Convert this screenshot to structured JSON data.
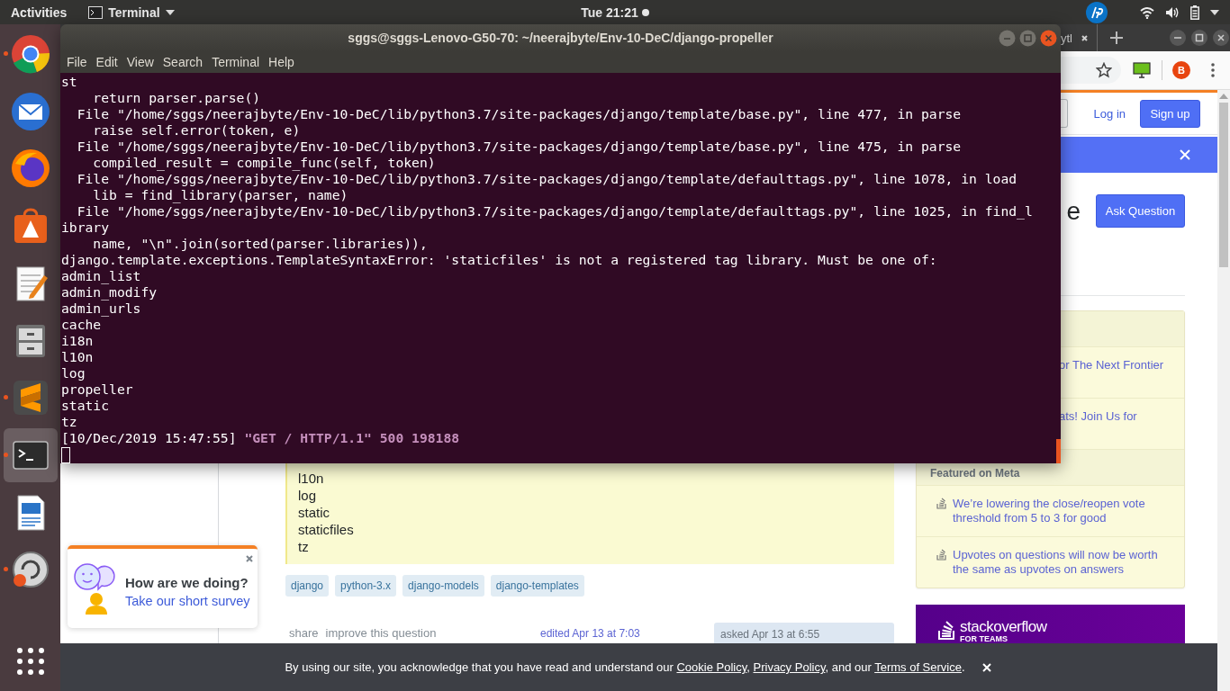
{
  "top_bar": {
    "activities": "Activities",
    "app_menu": "Terminal",
    "clock": "Tue 21:21",
    "notification": true
  },
  "dock": [
    {
      "kind": "chrome",
      "running": true,
      "selected": false
    },
    {
      "kind": "mail",
      "running": false,
      "selected": false
    },
    {
      "kind": "firefox",
      "running": false,
      "selected": false
    },
    {
      "kind": "store",
      "running": false,
      "selected": false
    },
    {
      "kind": "editor",
      "running": false,
      "selected": false
    },
    {
      "kind": "files",
      "running": false,
      "selected": false
    },
    {
      "kind": "sublime",
      "running": true,
      "selected": false
    },
    {
      "kind": "terminal",
      "running": true,
      "selected": true
    },
    {
      "kind": "writer",
      "running": false,
      "selected": false
    },
    {
      "kind": "updater",
      "running": true,
      "selected": false
    },
    {
      "kind": "apps",
      "running": false,
      "selected": false
    }
  ],
  "browser": {
    "tab": {
      "title": "ytl"
    },
    "avatar": "B",
    "page": {
      "login": "Log in",
      "signup": "Sign up",
      "title_fragment": "e",
      "ask_button": "Ask Question",
      "code_lines": [
        "l10n",
        "log",
        "static",
        "staticfiles",
        "tz"
      ],
      "tags": [
        "django",
        "python-3.x",
        "django-models",
        "django-templates"
      ],
      "post_menu": [
        "share",
        "improve this question"
      ],
      "edited": "edited Apr 13 at 7:03",
      "asked": "asked Apr 13 at 6:55",
      "sidebar": {
        "blog_items": [
          "or The Next Frontier",
          "ats! Join Us for"
        ],
        "meta_heading": "Featured on Meta",
        "meta_items": [
          "We’re lowering the close/reopen vote threshold from 5 to 3 for good",
          "Upvotes on questions will now be worth the same as upvotes on answers"
        ]
      },
      "teams_ad": {
        "logo": "stack**overflow**",
        "subtitle": "FOR TEAMS"
      },
      "survey": {
        "title": "How are we doing?",
        "link": "Take our short survey"
      },
      "cookie_notice": [
        {
          "kind": "text",
          "text": "By using our site, you acknowledge that you have read and understand our "
        },
        {
          "kind": "link",
          "text": "Cookie Policy"
        },
        {
          "kind": "text",
          "text": ", "
        },
        {
          "kind": "link",
          "text": "Privacy Policy"
        },
        {
          "kind": "text",
          "text": ", and our "
        },
        {
          "kind": "link",
          "text": "Terms of Service"
        },
        {
          "kind": "text",
          "text": "."
        }
      ]
    }
  },
  "terminal": {
    "title": "sggs@sggs-Lenovo-G50-70: ~/neerajbyte/Env-10-DeC/django-propeller",
    "menu": [
      "File",
      "Edit",
      "View",
      "Search",
      "Terminal",
      "Help"
    ],
    "lines": [
      "st",
      "    return parser.parse()",
      "  File \"/home/sggs/neerajbyte/Env-10-DeC/lib/python3.7/site-packages/django/template/base.py\", line 477, in parse",
      "    raise self.error(token, e)",
      "  File \"/home/sggs/neerajbyte/Env-10-DeC/lib/python3.7/site-packages/django/template/base.py\", line 475, in parse",
      "    compiled_result = compile_func(self, token)",
      "  File \"/home/sggs/neerajbyte/Env-10-DeC/lib/python3.7/site-packages/django/template/defaulttags.py\", line 1078, in load",
      "    lib = find_library(parser, name)",
      "  File \"/home/sggs/neerajbyte/Env-10-DeC/lib/python3.7/site-packages/django/template/defaulttags.py\", line 1025, in find_l",
      "ibrary",
      "    name, \"\\n\".join(sorted(parser.libraries)),",
      "django.template.exceptions.TemplateSyntaxError: 'staticfiles' is not a registered tag library. Must be one of:",
      "admin_list",
      "admin_modify",
      "admin_urls",
      "cache",
      "i18n",
      "l10n",
      "log",
      "propeller",
      "static",
      "tz"
    ],
    "log": {
      "time": "[10/Dec/2019 15:47:55]",
      "request": "\"GET / HTTP/1.1\" 500 198188"
    }
  }
}
